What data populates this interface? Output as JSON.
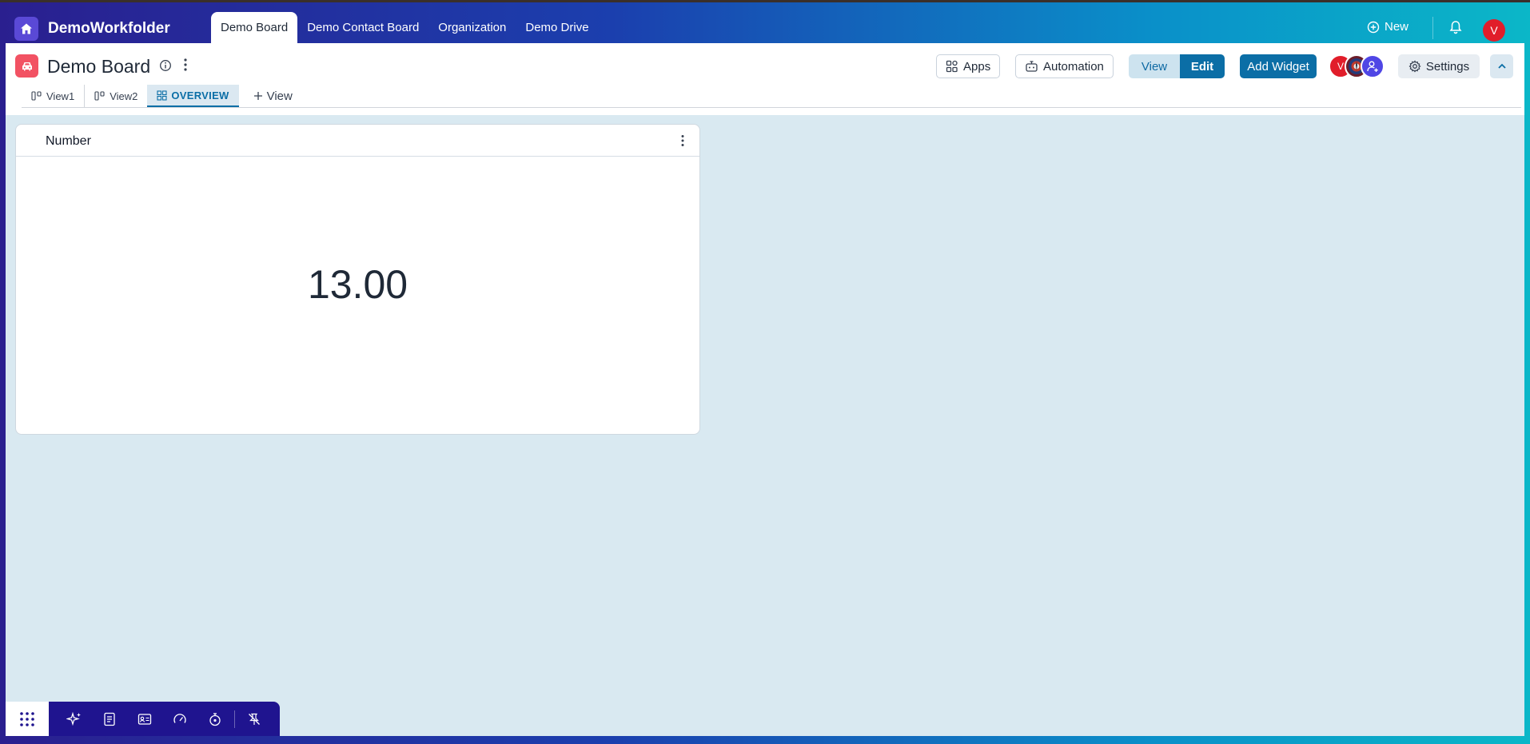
{
  "workspace": {
    "name": "DemoWorkfolder"
  },
  "top_tabs": [
    {
      "label": "Demo Board",
      "active": true
    },
    {
      "label": "Demo Contact Board",
      "active": false
    },
    {
      "label": "Organization",
      "active": false
    },
    {
      "label": "Demo Drive",
      "active": false
    }
  ],
  "topbar": {
    "new_label": "New",
    "user_initial": "V"
  },
  "board": {
    "title": "Demo Board",
    "apps_label": "Apps",
    "automation_label": "Automation",
    "view_label": "View",
    "edit_label": "Edit",
    "add_widget_label": "Add Widget",
    "settings_label": "Settings",
    "member_initial": "V"
  },
  "view_tabs": [
    {
      "label": "View1",
      "icon": "board-view-icon"
    },
    {
      "label": "View2",
      "icon": "board-view-icon"
    },
    {
      "label": "OVERVIEW",
      "icon": "dashboard-grid-icon",
      "active": true
    }
  ],
  "add_view_label": "View",
  "widget": {
    "title": "Number",
    "value": "13.00"
  },
  "colors": {
    "accent": "#0b6ea6",
    "board_icon": "#f25263",
    "avatar": "#e11d2a",
    "dock": "#1f148f",
    "canvas": "#d9e9f1"
  }
}
